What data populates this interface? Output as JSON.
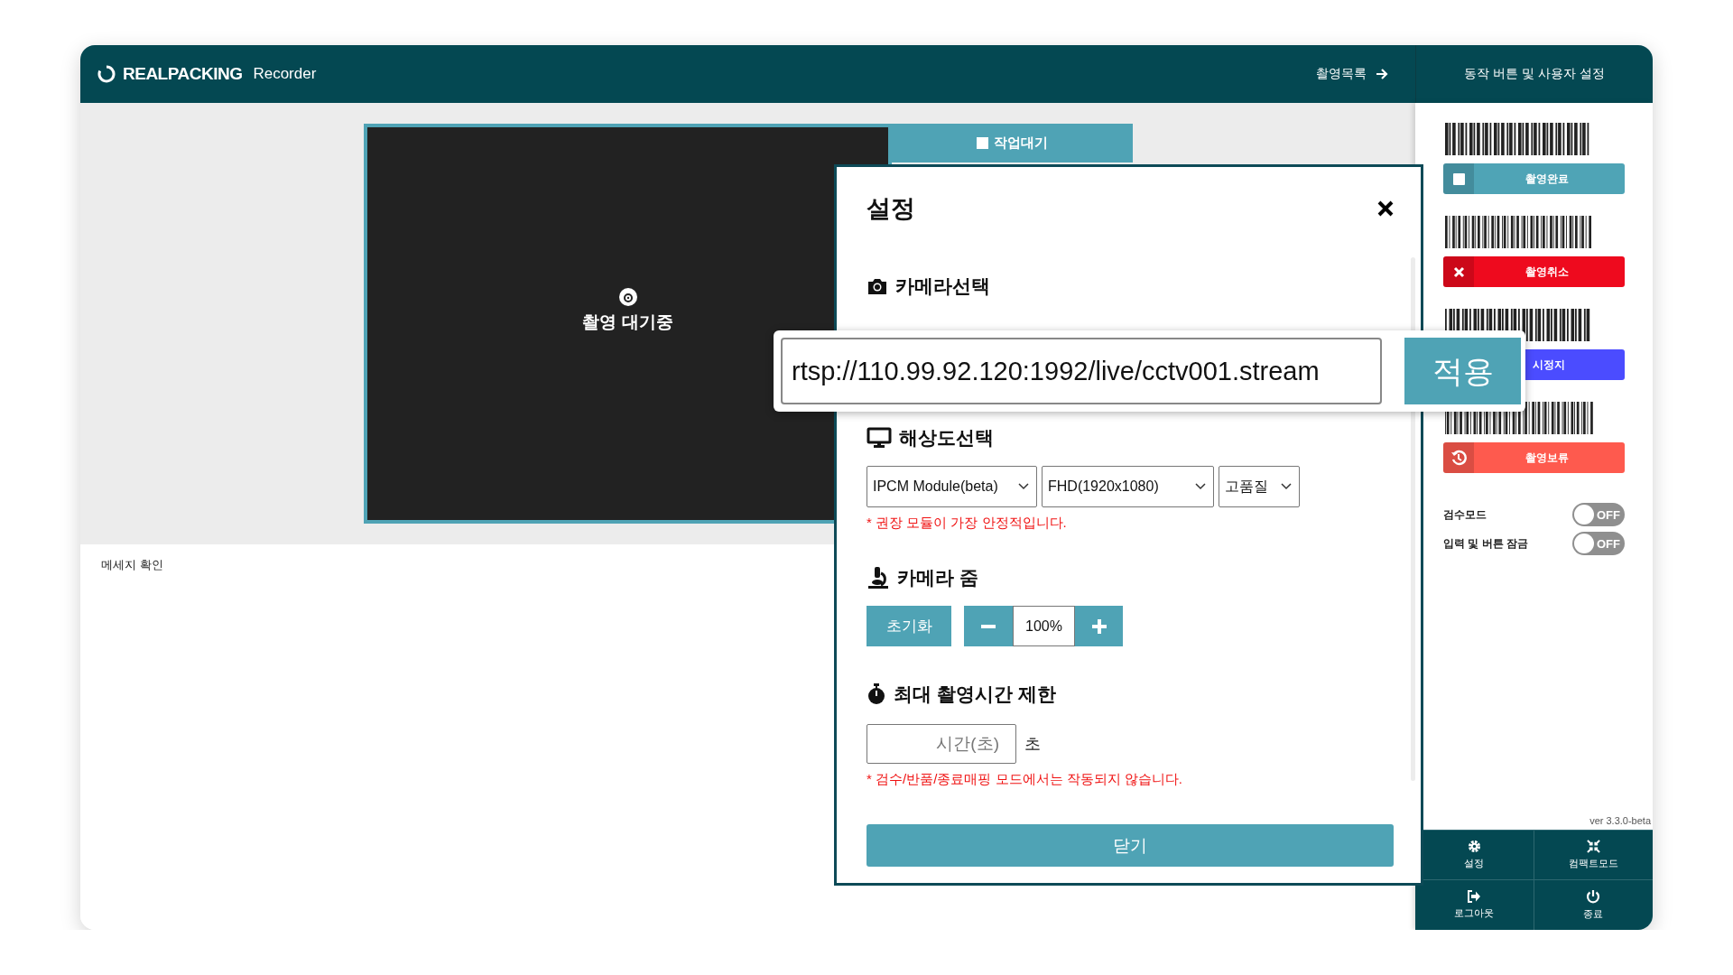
{
  "header": {
    "logo": "REALPACKING",
    "app_name": "Recorder",
    "list_link": "촬영목록",
    "panel_title": "동작 버튼 및 사용자 설정"
  },
  "preview": {
    "status": "촬영 대기중",
    "tab": "작업대기"
  },
  "message": {
    "label": "메세지 확인"
  },
  "settings_dialog": {
    "title": "설정",
    "camera": {
      "heading": "카메라선택"
    },
    "resolution": {
      "heading": "해상도선택",
      "selects": [
        "IPCM Module(beta)",
        "FHD(1920x1080)",
        "고품질"
      ],
      "note": "* 권장 모듈이 가장 안정적입니다."
    },
    "zoom": {
      "heading": "카메라 줌",
      "reset": "초기화",
      "value": "100%"
    },
    "time_limit": {
      "heading": "최대 촬영시간 제한",
      "placeholder": "시간(초)",
      "unit": "초",
      "note": "* 검수/반품/종료매핑 모드에서는 작동되지 않습니다."
    },
    "close_button": "닫기"
  },
  "url_callout": {
    "value": "rtsp://110.99.92.120:1992/live/cctv001.stream",
    "apply": "적용"
  },
  "action_buttons": [
    {
      "kind": "stop",
      "label": "촬영완료",
      "color": "#4fa4b6"
    },
    {
      "kind": "cancel",
      "label": "촬영취소",
      "color": "#ee0a1e"
    },
    {
      "kind": "pause",
      "label": "시정지",
      "color": "#4b4cff"
    },
    {
      "kind": "hold",
      "label": "촬영보류",
      "color": "#fe5a4e"
    }
  ],
  "toggles": [
    {
      "label": "검수모드",
      "text": "OFF",
      "on": false
    },
    {
      "label": "입력 및 버튼 잠금",
      "text": "OFF",
      "on": false
    }
  ],
  "version": "ver 3.3.0-beta",
  "footer_buttons": [
    {
      "kind": "settings",
      "label": "설정"
    },
    {
      "kind": "compact",
      "label": "컴팩트모드"
    },
    {
      "kind": "logout",
      "label": "로그아웃"
    },
    {
      "kind": "power",
      "label": "종료"
    }
  ]
}
